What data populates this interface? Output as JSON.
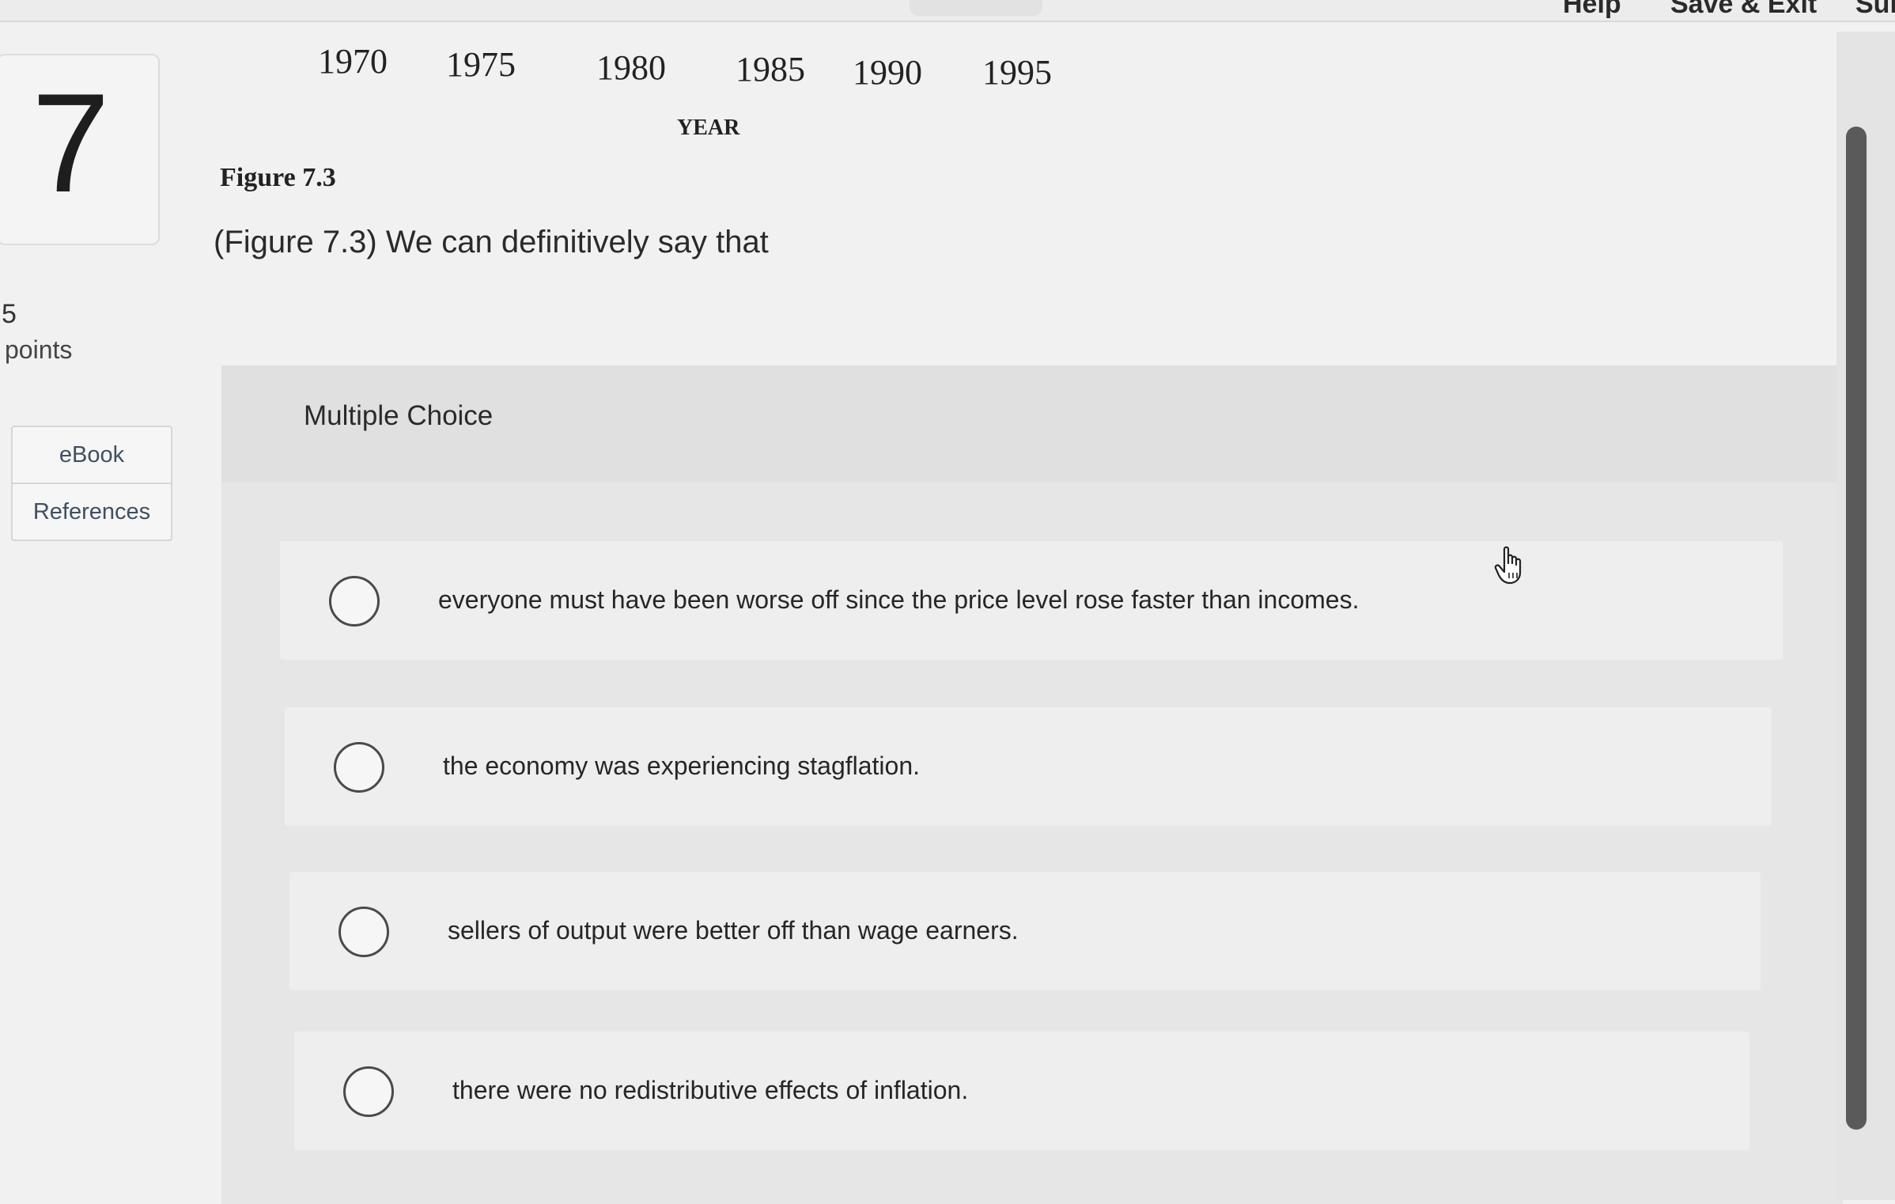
{
  "topbar": {
    "help_label": "Help",
    "save_exit_label": "Save & Exit",
    "submit_label": "Sul"
  },
  "figure": {
    "years": [
      "1970",
      "1975",
      "1980",
      "1985",
      "1990",
      "1995"
    ],
    "xlabel": "YEAR",
    "caption": "Figure 7.3"
  },
  "question": {
    "number": "7",
    "points_value": "5",
    "points_label": "points",
    "text": "(Figure 7.3) We can definitively say that"
  },
  "sidebar": {
    "ebook_label": "eBook",
    "references_label": "References"
  },
  "multiple_choice": {
    "title": "Multiple Choice",
    "options": [
      "everyone must have been worse off since the price level rose faster than incomes.",
      "the economy was experiencing stagflation.",
      "sellers of output were better off than wage earners.",
      "there were no redistributive effects of inflation."
    ]
  },
  "icons": {
    "cursor": "hand-pointer-icon"
  }
}
